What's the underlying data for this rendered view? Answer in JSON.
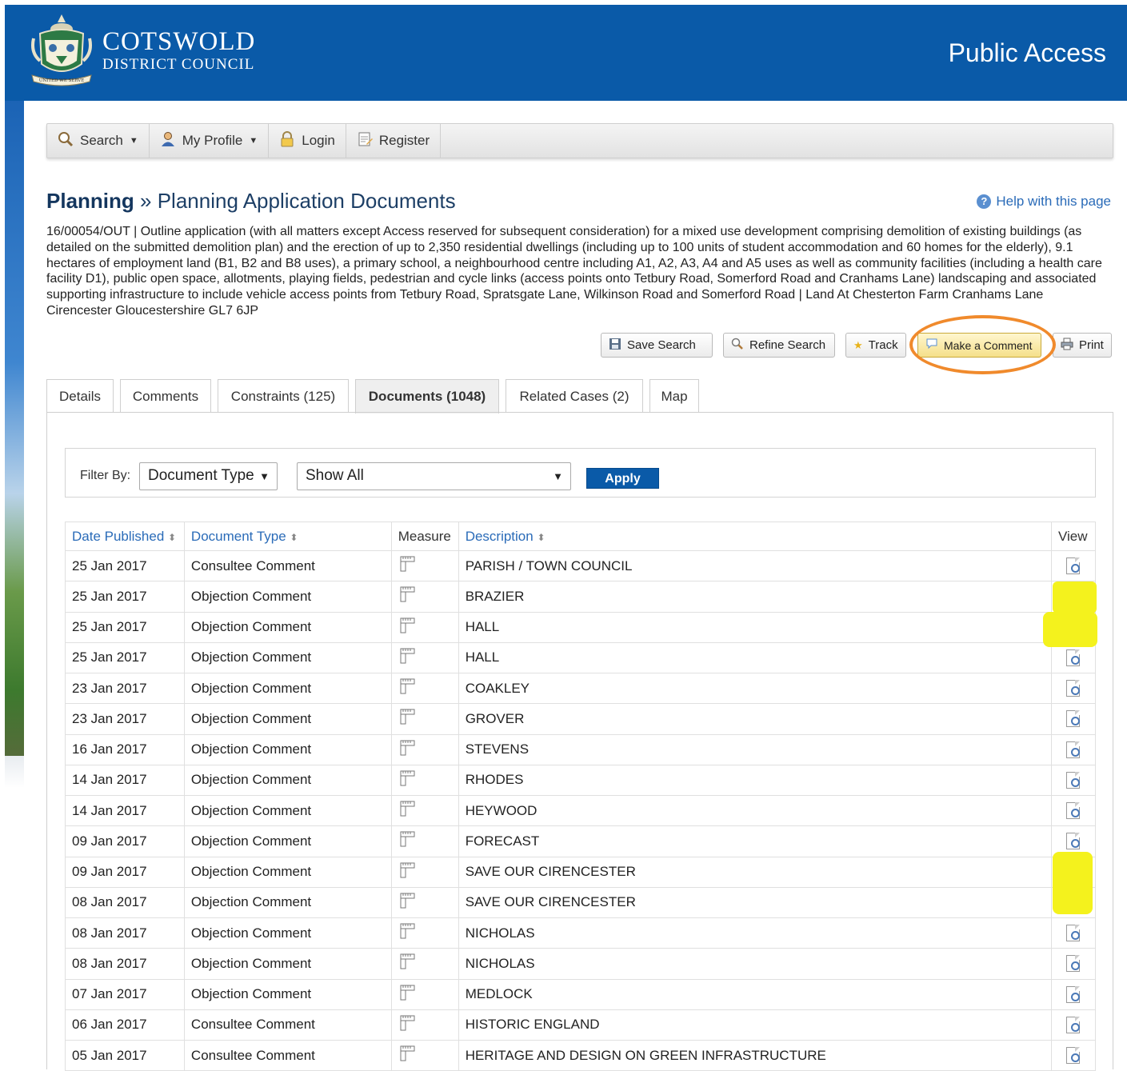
{
  "header": {
    "brand_line1": "COTSWOLD",
    "brand_line2": "DISTRICT COUNCIL",
    "crest_text": "UNITED WE SERVE",
    "portal_title": "Public Access"
  },
  "menu": {
    "search": "Search",
    "my_profile": "My Profile",
    "login": "Login",
    "register": "Register"
  },
  "page": {
    "section": "Planning",
    "separator": "»",
    "title": "Planning Application Documents",
    "help": "Help with this page",
    "application_summary": "16/00054/OUT | Outline application (with all matters except Access reserved for subsequent consideration) for a mixed use development comprising demolition of existing buildings (as detailed on the submitted demolition plan) and the erection of up to 2,350 residential dwellings (including up to 100 units of student accommodation and 60 homes for the elderly), 9.1 hectares of employment land (B1, B2 and B8 uses), a primary school, a neighbourhood centre including A1, A2, A3, A4 and A5 uses as well as community facilities (including a health care facility D1), public open space, allotments, playing fields, pedestrian and cycle links (access points onto Tetbury Road, Somerford Road and Cranhams Lane) landscaping and associated supporting infrastructure to include vehicle access points from Tetbury Road, Spratsgate Lane, Wilkinson Road and Somerford Road | Land At Chesterton Farm Cranhams Lane Cirencester Gloucestershire GL7 6JP"
  },
  "actions": {
    "save_search": "Save Search",
    "refine_search": "Refine Search",
    "track": "Track",
    "make_comment": "Make a Comment",
    "print": "Print"
  },
  "tabs": [
    "Details",
    "Comments",
    "Constraints (125)",
    "Documents (1048)",
    "Related Cases (2)",
    "Map"
  ],
  "active_tab": "Documents (1048)",
  "filter": {
    "label": "Filter By:",
    "type_value": "Document Type",
    "show_value": "Show All",
    "apply": "Apply"
  },
  "table": {
    "headers": {
      "date": "Date Published",
      "type": "Document Type",
      "measure": "Measure",
      "description": "Description",
      "view": "View"
    },
    "rows": [
      {
        "date": "25 Jan 2017",
        "type": "Consultee Comment",
        "description": "PARISH / TOWN COUNCIL"
      },
      {
        "date": "25 Jan 2017",
        "type": "Objection Comment",
        "description": "BRAZIER"
      },
      {
        "date": "25 Jan 2017",
        "type": "Objection Comment",
        "description": "HALL"
      },
      {
        "date": "25 Jan 2017",
        "type": "Objection Comment",
        "description": "HALL"
      },
      {
        "date": "23 Jan 2017",
        "type": "Objection Comment",
        "description": "COAKLEY"
      },
      {
        "date": "23 Jan 2017",
        "type": "Objection Comment",
        "description": "GROVER"
      },
      {
        "date": "16 Jan 2017",
        "type": "Objection Comment",
        "description": "STEVENS"
      },
      {
        "date": "14 Jan 2017",
        "type": "Objection Comment",
        "description": "RHODES"
      },
      {
        "date": "14 Jan 2017",
        "type": "Objection Comment",
        "description": "HEYWOOD"
      },
      {
        "date": "09 Jan 2017",
        "type": "Objection Comment",
        "description": "FORECAST"
      },
      {
        "date": "09 Jan 2017",
        "type": "Objection Comment",
        "description": "SAVE OUR CIRENCESTER"
      },
      {
        "date": "08 Jan 2017",
        "type": "Objection Comment",
        "description": "SAVE OUR CIRENCESTER"
      },
      {
        "date": "08 Jan 2017",
        "type": "Objection Comment",
        "description": "NICHOLAS"
      },
      {
        "date": "08 Jan 2017",
        "type": "Objection Comment",
        "description": "NICHOLAS"
      },
      {
        "date": "07 Jan 2017",
        "type": "Objection Comment",
        "description": "MEDLOCK"
      },
      {
        "date": "06 Jan 2017",
        "type": "Consultee Comment",
        "description": "HISTORIC ENGLAND"
      },
      {
        "date": "05 Jan 2017",
        "type": "Consultee Comment",
        "description": "HERITAGE AND DESIGN ON GREEN INFRASTRUCTURE"
      }
    ]
  },
  "colors": {
    "header_blue": "#0a5aa8",
    "link_blue": "#2a6bb8",
    "annotation_orange": "#f08a2c",
    "annotation_yellow": "#f4f21d"
  }
}
